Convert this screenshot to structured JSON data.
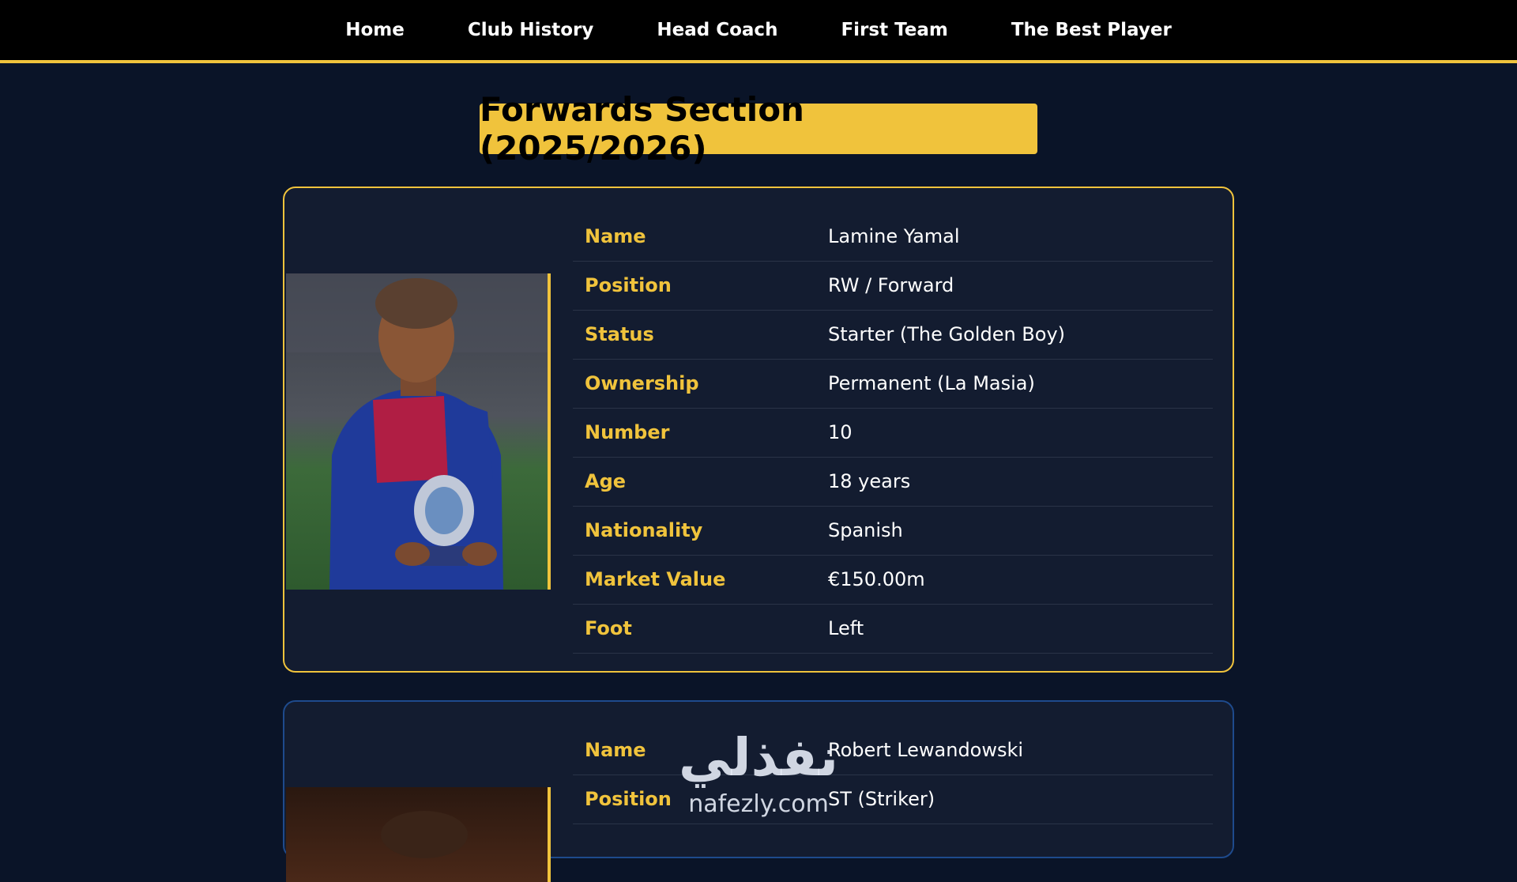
{
  "nav": {
    "links": [
      "Home",
      "Club History",
      "Head Coach",
      "First Team",
      "The Best Player"
    ]
  },
  "section_title": "Forwards Section (2025/2026)",
  "players": [
    {
      "rows": [
        {
          "label": "Name",
          "value": "Lamine Yamal"
        },
        {
          "label": "Position",
          "value": "RW / Forward"
        },
        {
          "label": "Status",
          "value": "Starter (The Golden Boy)"
        },
        {
          "label": "Ownership",
          "value": "Permanent (La Masia)"
        },
        {
          "label": "Number",
          "value": "10"
        },
        {
          "label": "Age",
          "value": "18 years"
        },
        {
          "label": "Nationality",
          "value": "Spanish"
        },
        {
          "label": "Market Value",
          "value": "€150.00m"
        },
        {
          "label": "Foot",
          "value": "Left"
        }
      ]
    },
    {
      "rows": [
        {
          "label": "Name",
          "value": "Robert Lewandowski"
        },
        {
          "label": "Position",
          "value": "ST (Striker)"
        }
      ]
    }
  ],
  "watermark": {
    "arabic": "نفذلي",
    "latin": "nafezly.com"
  },
  "colors": {
    "accent": "#f0c33c",
    "background": "#0a1428",
    "card": "#131c30",
    "card2_border": "#1e4a8c"
  }
}
